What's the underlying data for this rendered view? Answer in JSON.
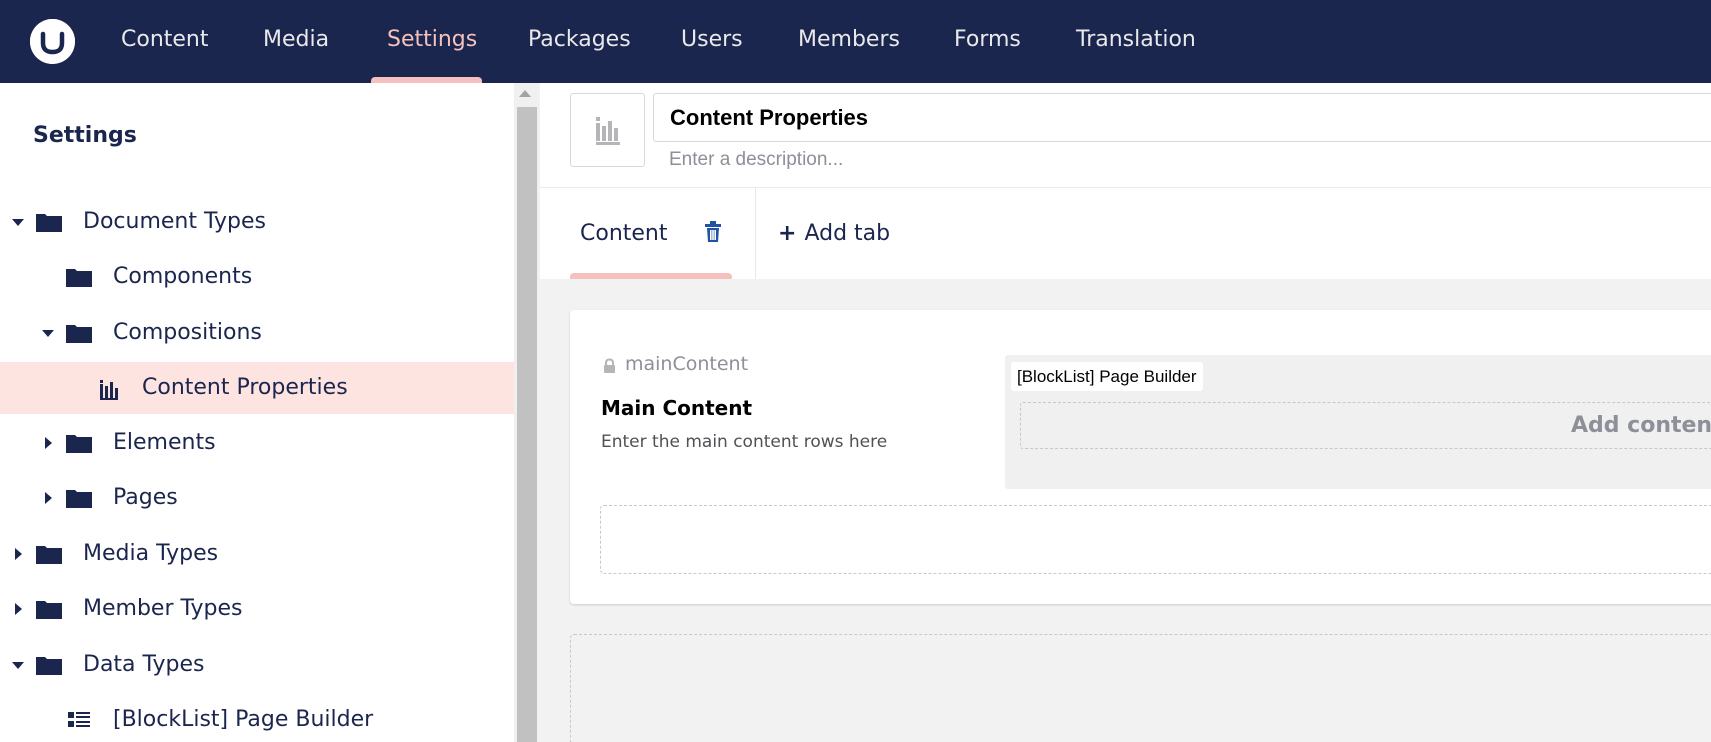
{
  "topbar": {
    "logo_icon": "umbraco-logo",
    "nav": [
      {
        "label": "Content",
        "active": false
      },
      {
        "label": "Media",
        "active": false
      },
      {
        "label": "Settings",
        "active": true
      },
      {
        "label": "Packages",
        "active": false
      },
      {
        "label": "Users",
        "active": false
      },
      {
        "label": "Members",
        "active": false
      },
      {
        "label": "Forms",
        "active": false
      },
      {
        "label": "Translation",
        "active": false
      }
    ]
  },
  "tree": {
    "title": "Settings",
    "items": [
      {
        "label": "Document Types",
        "icon": "folder-icon",
        "expanded": true
      },
      {
        "label": "Components",
        "icon": "folder-icon",
        "expanded": false
      },
      {
        "label": "Compositions",
        "icon": "folder-icon",
        "expanded": true
      },
      {
        "label": "Content Properties",
        "icon": "document-type-icon",
        "selected": true
      },
      {
        "label": "Elements",
        "icon": "folder-icon",
        "expanded": false
      },
      {
        "label": "Pages",
        "icon": "folder-icon",
        "expanded": false
      },
      {
        "label": "Media Types",
        "icon": "folder-icon",
        "expanded": false
      },
      {
        "label": "Member Types",
        "icon": "folder-icon",
        "expanded": false
      },
      {
        "label": "Data Types",
        "icon": "folder-icon",
        "expanded": true
      },
      {
        "label": "[BlockList] Page Builder",
        "icon": "block-list-icon"
      }
    ]
  },
  "editor": {
    "icon": "document-type-icon",
    "name_value": "Content Properties",
    "description_placeholder": "Enter a description...",
    "tabs": [
      {
        "label": "Content",
        "active": true
      }
    ],
    "add_tab_label": "Add tab",
    "property": {
      "alias": "mainContent",
      "name": "Main Content",
      "description": "Enter the main content rows here",
      "editor_badge": "[BlockList] Page Builder",
      "add_content_label": "Add content"
    }
  },
  "colors": {
    "header_bg": "#1b264f",
    "active_accent": "#f5c1bc",
    "selected_row_bg": "#fde4e1",
    "trash_icon": "#2152a3"
  }
}
